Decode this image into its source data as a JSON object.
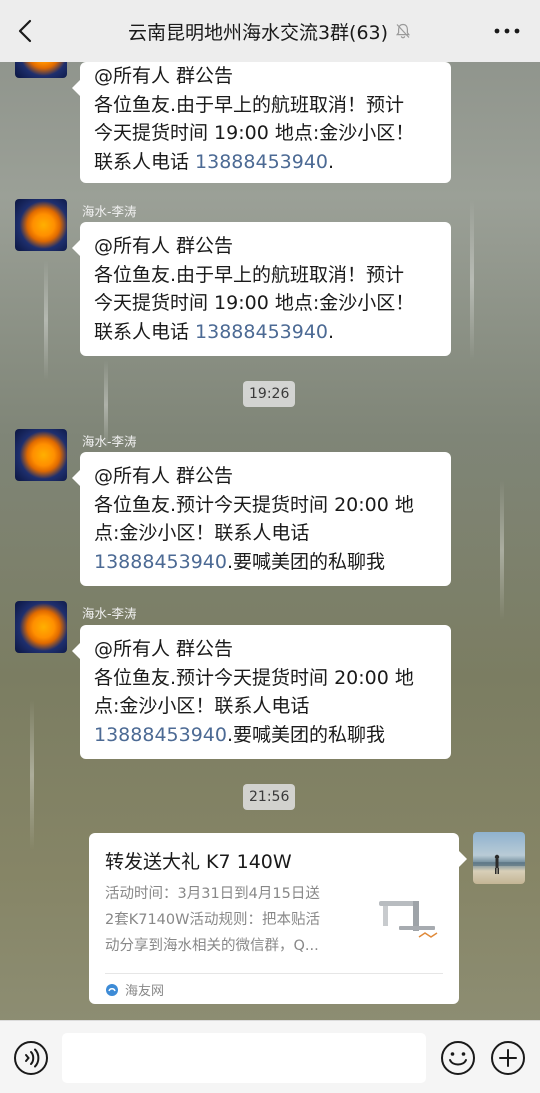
{
  "header": {
    "title": "云南昆明地州海水交流3群(63)",
    "back_icon": "chevron-left-icon",
    "mute_icon": "bell-off-icon",
    "more_icon": "more-horizontal-icon"
  },
  "messages": [
    {
      "sender": "",
      "lines": [
        "@所有人  群公告",
        "各位鱼友.由于早上的航班取消！预计",
        "今天提货时间 19:00 地点:金沙小区！"
      ],
      "contact_prefix": "联系人电话 ",
      "phone": "13888453940",
      "contact_suffix": "."
    },
    {
      "sender": "海水-李涛",
      "lines": [
        "@所有人  群公告",
        "各位鱼友.由于早上的航班取消！预计",
        "今天提货时间 19:00 地点:金沙小区！"
      ],
      "contact_prefix": "联系人电话 ",
      "phone": "13888453940",
      "contact_suffix": "."
    },
    {
      "sender": "海水-李涛",
      "lines": [
        "@所有人  群公告",
        "各位鱼友.预计今天提货时间 20:00 地",
        "点:金沙小区！联系人电话"
      ],
      "phone": "13888453940",
      "contact_suffix": ".要喊美团的私聊我"
    },
    {
      "sender": "海水-李涛",
      "lines": [
        "@所有人  群公告",
        "各位鱼友.预计今天提货时间 20:00 地",
        "点:金沙小区！联系人电话"
      ],
      "phone": "13888453940",
      "contact_suffix": ".要喊美团的私聊我"
    }
  ],
  "timestamps": [
    "19:26",
    "21:56"
  ],
  "share_card": {
    "title": "转发送大礼 K7 140W",
    "desc_lines": [
      "活动时间：3月31日到4月15日送",
      "2套K7140W活动规则：把本贴活",
      "动分享到海水相关的微信群，Q..."
    ],
    "source": "海友网",
    "thumb_icon": "aquarium-light-image"
  },
  "input_bar": {
    "voice_icon": "voice-icon",
    "input_value": "",
    "emoji_icon": "emoji-icon",
    "plus_icon": "plus-icon"
  },
  "colors": {
    "link": "#4c6a94",
    "bubble": "#ffffff",
    "topbar": "#ededed"
  }
}
